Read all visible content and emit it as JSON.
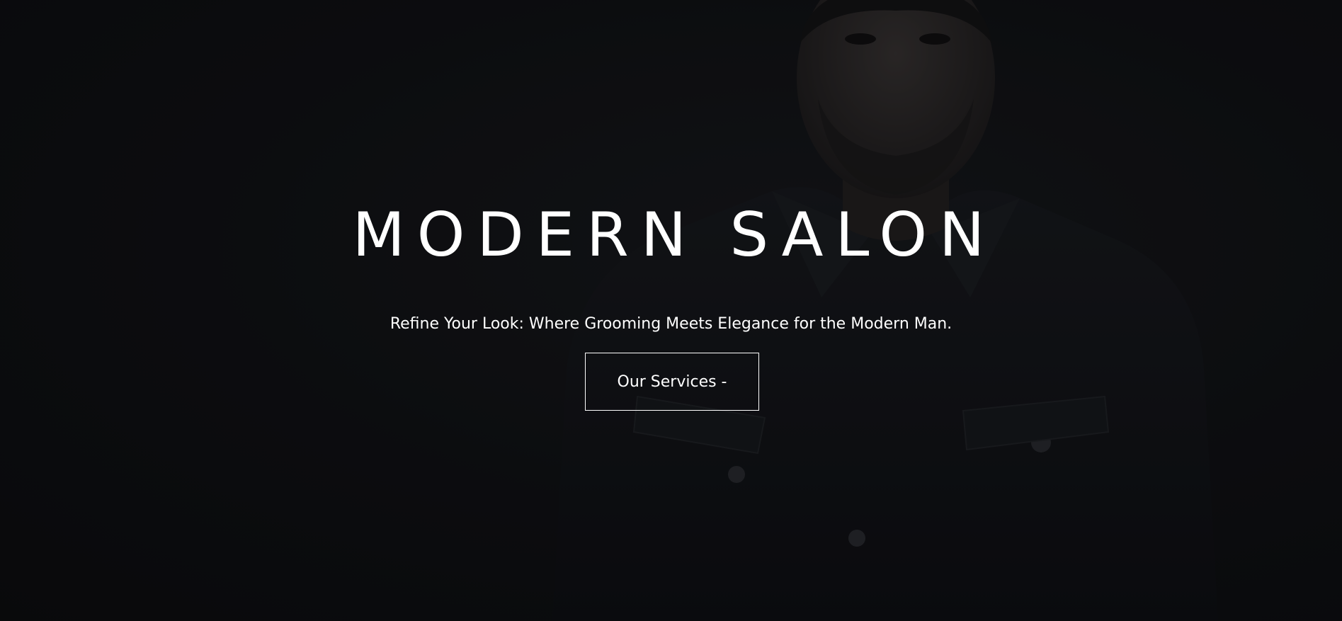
{
  "hero": {
    "title": "MODERN SALON",
    "subtitle": "Refine Your Look: Where Grooming Meets Elegance for the Modern Man.",
    "cta_label": "Our Services -",
    "background_image": "darkened-portrait-man-denim-jacket"
  },
  "colors": {
    "background": "#0d0e10",
    "text": "#ffffff",
    "button_border": "#ffffff"
  }
}
